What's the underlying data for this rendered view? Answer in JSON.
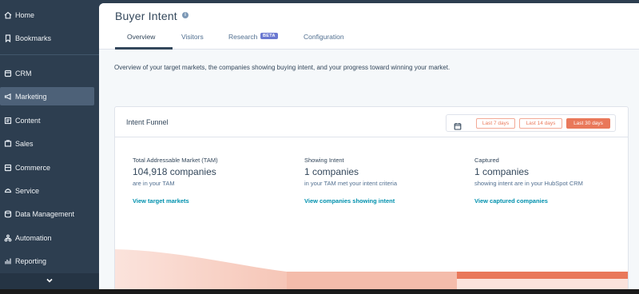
{
  "sidebar": {
    "items": [
      {
        "label": "Home",
        "icon": "home-icon"
      },
      {
        "label": "Bookmarks",
        "icon": "bookmark-icon"
      },
      {
        "label": "CRM",
        "icon": "crm-icon"
      },
      {
        "label": "Marketing",
        "icon": "megaphone-icon"
      },
      {
        "label": "Content",
        "icon": "content-icon"
      },
      {
        "label": "Sales",
        "icon": "sales-icon"
      },
      {
        "label": "Commerce",
        "icon": "commerce-icon"
      },
      {
        "label": "Service",
        "icon": "service-icon"
      },
      {
        "label": "Data Management",
        "icon": "database-icon"
      },
      {
        "label": "Automation",
        "icon": "automation-icon"
      },
      {
        "label": "Reporting",
        "icon": "reporting-icon"
      }
    ],
    "active": "Marketing"
  },
  "header": {
    "title": "Buyer Intent",
    "tabs": [
      {
        "label": "Overview",
        "active": true
      },
      {
        "label": "Visitors",
        "active": false
      },
      {
        "label": "Research",
        "active": false
      },
      {
        "label": "Configuration",
        "active": false
      }
    ],
    "beta_label": "BETA"
  },
  "overview_text": "Overview of your target markets, the companies showing buying intent, and your progress toward winning your market.",
  "card": {
    "title": "Intent Funnel",
    "ranges": [
      {
        "label": "Last 7 days",
        "selected": false
      },
      {
        "label": "Last 14 days",
        "selected": false
      },
      {
        "label": "Last 30 days",
        "selected": true
      }
    ],
    "metrics": [
      {
        "label": "Total Addressable Market (TAM)",
        "value": "104,918 companies",
        "sub": "are in your TAM",
        "link": "View target markets"
      },
      {
        "label": "Showing Intent",
        "value": "1 companies",
        "sub": "in your TAM met your intent criteria",
        "link": "View companies showing intent"
      },
      {
        "label": "Captured",
        "value": "1 companies",
        "sub": "showing intent are in your HubSpot CRM",
        "link": "View captured companies"
      }
    ]
  },
  "colors": {
    "sidebar_bg": "#2d3e50",
    "active_item": "#4d6178",
    "accent": "#e9785a",
    "link": "#0091ae",
    "beta": "#6a78d1"
  }
}
